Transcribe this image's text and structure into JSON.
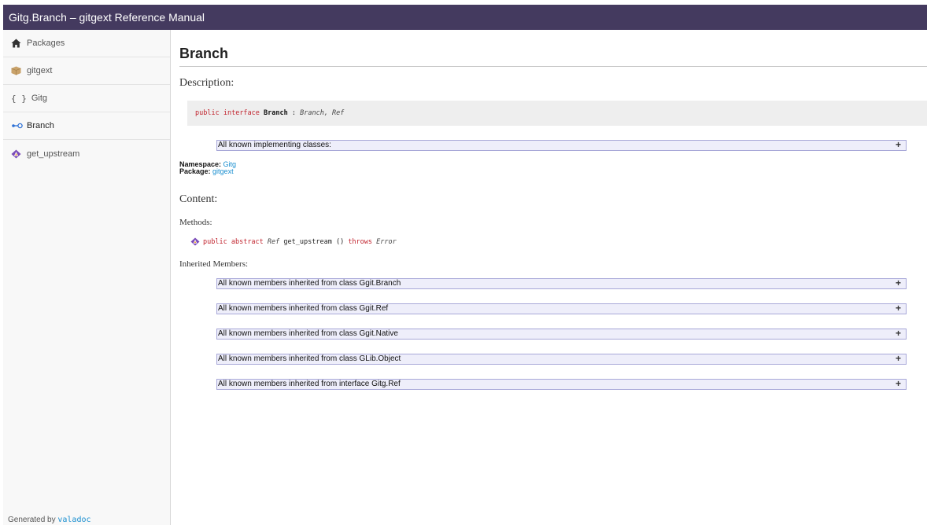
{
  "window": {
    "title": "Gitg.Branch – gitgext Reference Manual"
  },
  "sidebar": {
    "items": [
      {
        "label": "Packages",
        "icon": "home-icon"
      },
      {
        "label": "gitgext",
        "icon": "package-icon"
      },
      {
        "label": "Gitg",
        "icon": "namespace-braces-icon",
        "glyph": "{ }"
      },
      {
        "label": "Branch",
        "icon": "interface-icon"
      },
      {
        "label": "get_upstream",
        "icon": "abstract-method-icon"
      }
    ],
    "footer": {
      "prefix": "Generated by ",
      "link": "valadoc"
    }
  },
  "main": {
    "title": "Branch",
    "description_heading": "Description:",
    "signature": {
      "kw1": "public",
      "kw2": "interface",
      "name": "Branch",
      "sep": " : ",
      "types": "Branch, Ref"
    },
    "implementing_label": "All known implementing classes:",
    "toggle_symbol": "+",
    "namespace_label": "Namespace:",
    "namespace_value": "Gitg",
    "package_label": "Package:",
    "package_value": "gitgext",
    "content_heading": "Content:",
    "methods_heading": "Methods:",
    "method": {
      "kw1": "public",
      "kw2": "abstract",
      "return_type": "Ref",
      "name": "get_upstream",
      "params": " () ",
      "throws_kw": "throws",
      "throws_type": "Error"
    },
    "inherited_heading": "Inherited Members:",
    "inherited": [
      "All known members inherited from class Ggit.Branch",
      "All known members inherited from class Ggit.Ref",
      "All known members inherited from class Ggit.Native",
      "All known members inherited from class GLib.Object",
      "All known members inherited from interface Gitg.Ref"
    ]
  },
  "colors": {
    "titlebar_bg": "#443a5f",
    "keyword": "#c1242e",
    "link": "#1a8fd0",
    "collapse_bg": "#eeeefa",
    "collapse_border": "#a8a8d8"
  }
}
